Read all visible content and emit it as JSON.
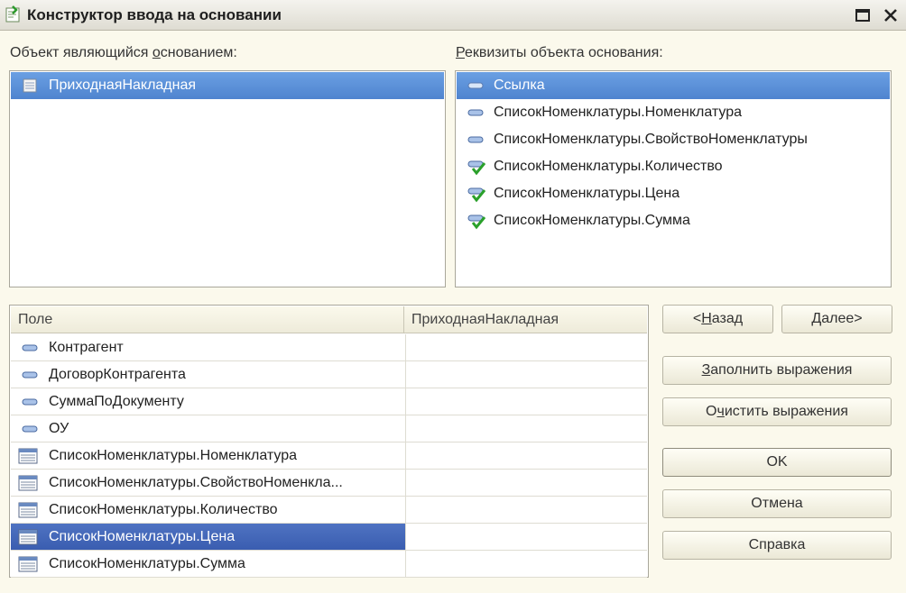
{
  "window": {
    "title": "Конструктор ввода на основании"
  },
  "left_panel": {
    "label_pre": "Объект являющийся ",
    "label_ul": "о",
    "label_post": "снованием:",
    "items": [
      {
        "label": "ПриходнаяНакладная",
        "selected": true
      }
    ]
  },
  "right_panel": {
    "label_ul": "Р",
    "label_post": "еквизиты объекта основания:",
    "items": [
      {
        "label": "Ссылка",
        "icon": "attribute-icon",
        "selected": true
      },
      {
        "label": "СписокНоменклатуры.Номенклатура",
        "icon": "attribute-icon"
      },
      {
        "label": "СписокНоменклатуры.СвойствоНоменклатуры",
        "icon": "attribute-icon"
      },
      {
        "label": "СписокНоменклатуры.Количество",
        "icon": "attribute-check-icon"
      },
      {
        "label": "СписокНоменклатуры.Цена",
        "icon": "attribute-check-icon"
      },
      {
        "label": "СписокНоменклатуры.Сумма",
        "icon": "attribute-check-icon"
      }
    ]
  },
  "grid": {
    "col1": "Поле",
    "col2": "ПриходнаяНакладная",
    "rows": [
      {
        "field": "Контрагент",
        "icon": "attribute-icon",
        "value": ""
      },
      {
        "field": "ДоговорКонтрагента",
        "icon": "attribute-icon",
        "value": ""
      },
      {
        "field": "СуммаПоДокументу",
        "icon": "attribute-icon",
        "value": ""
      },
      {
        "field": "ОУ",
        "icon": "attribute-icon",
        "value": ""
      },
      {
        "field": "СписокНоменклатуры.Номенклатура",
        "icon": "table-icon",
        "value": ""
      },
      {
        "field": "СписокНоменклатуры.СвойствоНоменкла...",
        "icon": "table-icon",
        "value": ""
      },
      {
        "field": "СписокНоменклатуры.Количество",
        "icon": "table-icon",
        "value": ""
      },
      {
        "field": "СписокНоменклатуры.Цена",
        "icon": "table-icon",
        "value": "",
        "selected": true
      },
      {
        "field": "СписокНоменклатуры.Сумма",
        "icon": "table-icon",
        "value": ""
      }
    ]
  },
  "buttons": {
    "back_pre": "<",
    "back_ul": "Н",
    "back_post": "азад",
    "next_ul": "Д",
    "next_post": "алее>",
    "fill_ul": "З",
    "fill_post": "аполнить выражения",
    "clear_pre": "О",
    "clear_ul": "ч",
    "clear_post": "истить выражения",
    "ok": "OK",
    "cancel": "Отмена",
    "help": "Справка"
  },
  "colors": {
    "selection": "#5b8fd6",
    "grid_selection": "#3f62b4",
    "background": "#fbf9ec"
  }
}
